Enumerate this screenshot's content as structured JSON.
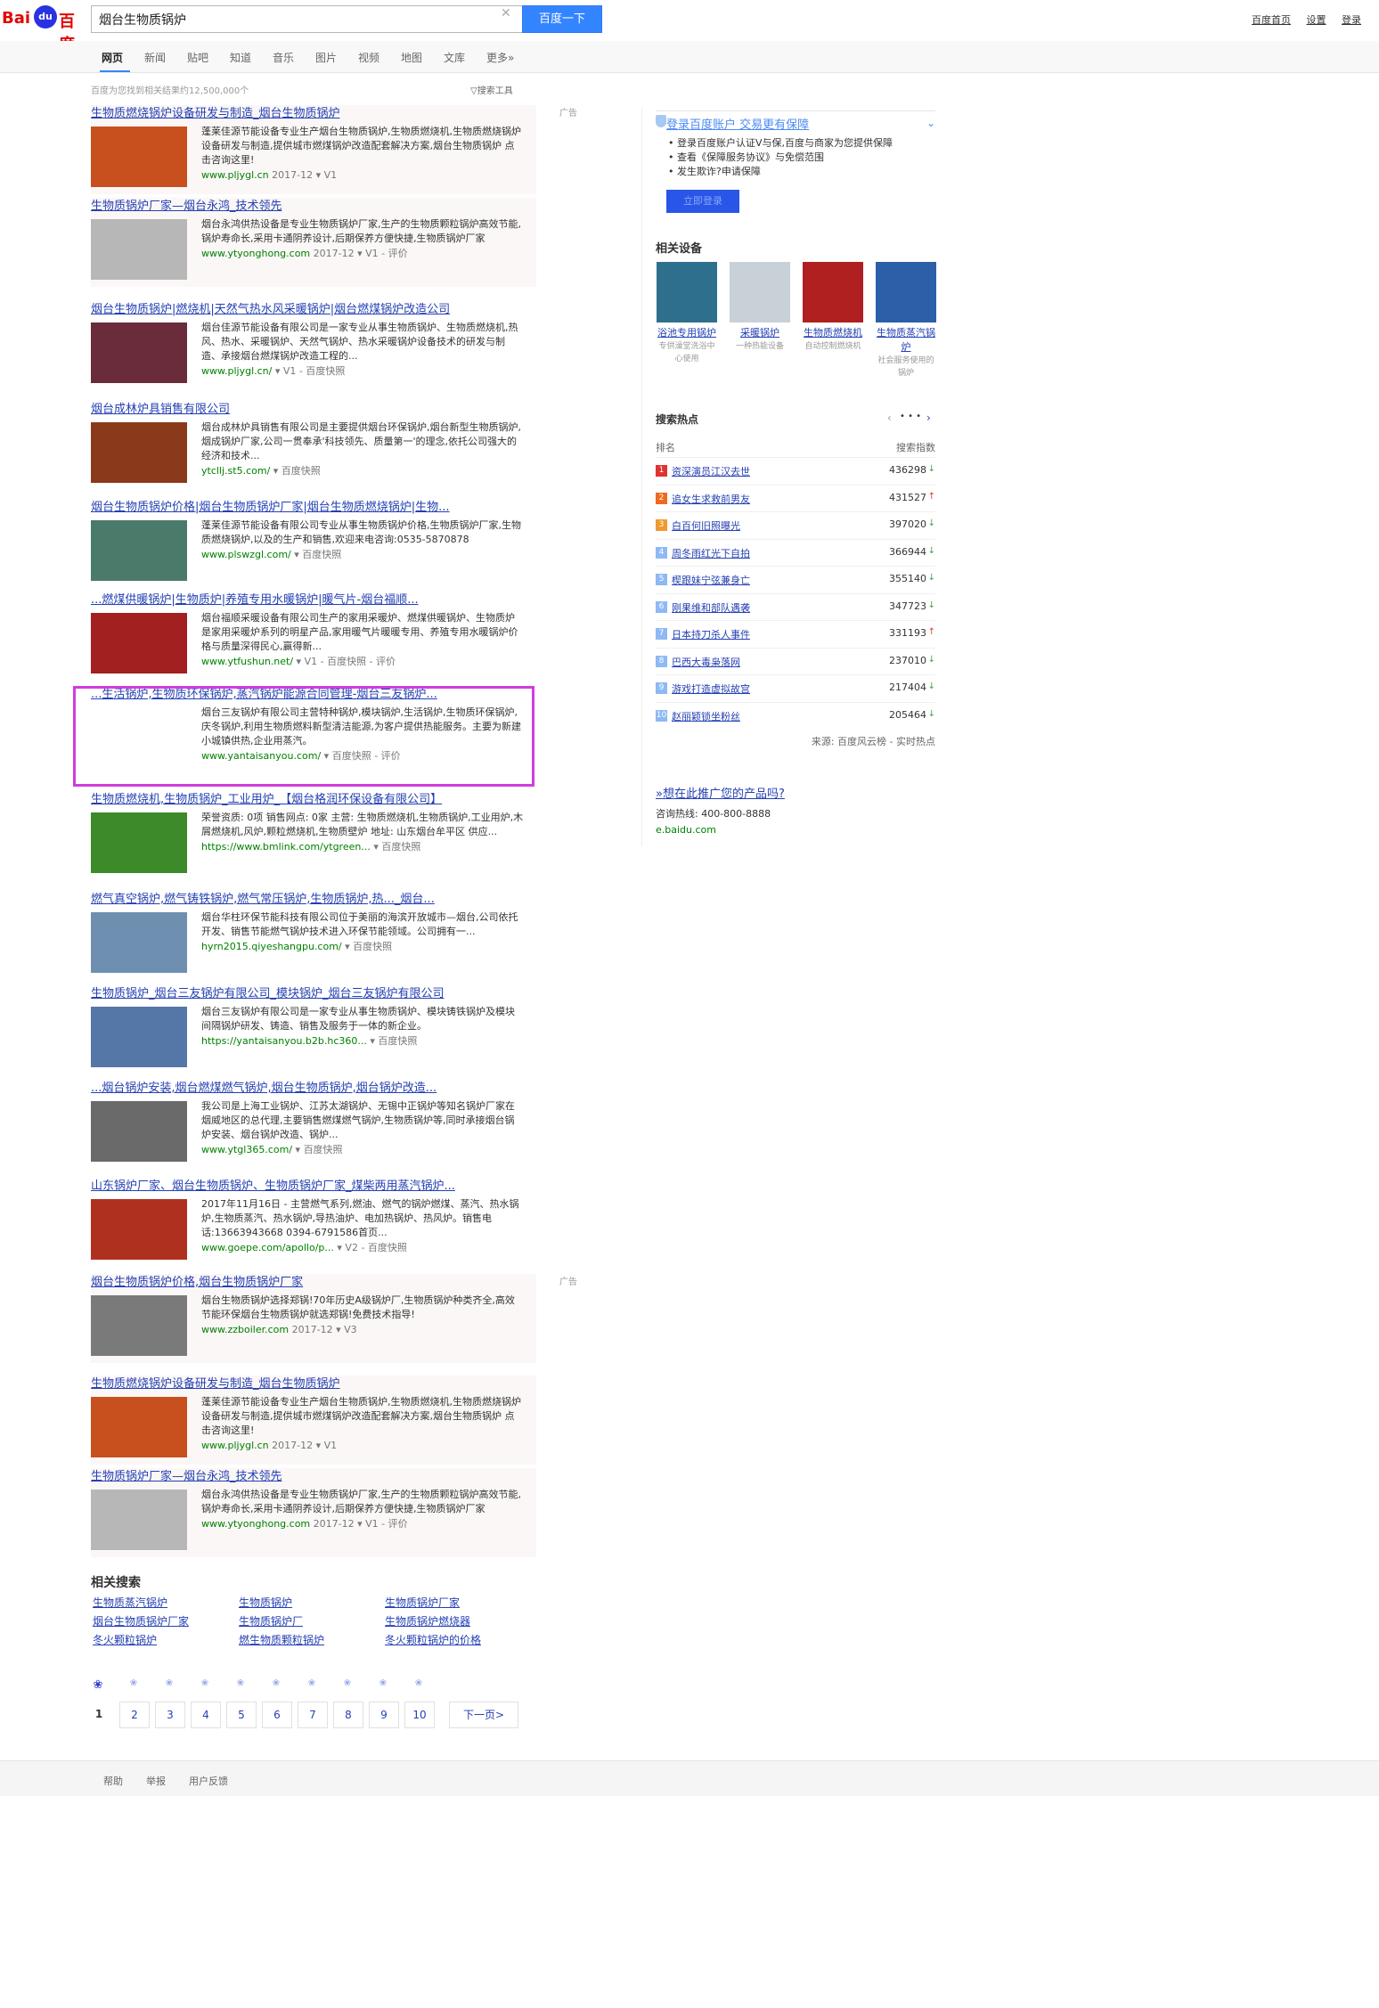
{
  "header": {
    "logo_left": "Bai",
    "logo_paw": "du",
    "logo_right": "百度",
    "query": "烟台生物质锅炉",
    "search_button": "百度一下",
    "links": [
      "百度首页",
      "设置",
      "登录"
    ]
  },
  "tabs": [
    "网页",
    "新闻",
    "贴吧",
    "知道",
    "音乐",
    "图片",
    "视频",
    "地图",
    "文库",
    "更多»"
  ],
  "result_count": "百度为您找到相关结果约12,500,000个",
  "search_tools": "搜索工具",
  "ad_label": "广告",
  "results": [
    {
      "title": "生物质燃烧锅炉设备研发与制造_烟台生物质锅炉",
      "snippet": "蓬莱佳源节能设备专业生产烟台生物质锅炉,生物质燃烧机,生物质燃烧锅炉设备研发与制造,提供城市燃煤锅炉改造配套解决方案,烟台生物质锅炉 点击咨询这里!",
      "source": "www.pljygl.cn",
      "date": "2017-12",
      "extra": "V1"
    },
    {
      "title": "生物质锅炉厂家—烟台永鸿_技术领先",
      "snippet": "烟台永鸿供热设备是专业生物质锅炉厂家,生产的生物质颗粒锅炉高效节能,锅炉寿命长,采用卡通阴养设计,后期保养方便快捷,生物质锅炉厂家",
      "source": "www.ytyonghong.com",
      "date": "2017-12",
      "extra": "V1 - 评价"
    },
    {
      "title": "烟台生物质锅炉|燃烧机|天然气热水风采暖锅炉|烟台燃煤锅炉改造公司",
      "snippet": "烟台佳源节能设备有限公司是一家专业从事生物质锅炉、生物质燃烧机,热风、热水、采暖锅炉、天然气锅炉、热水采暖锅炉设备技术的研发与制造、承接烟台燃煤锅炉改造工程的...",
      "source": "www.pljygl.cn/",
      "date": "",
      "extra": "V1 - 百度快照"
    },
    {
      "title": "烟台成林炉具销售有限公司",
      "snippet": "烟台成林炉具销售有限公司是主要提供烟台环保锅炉,烟台新型生物质锅炉,烟成锅炉厂家,公司一贯奉承'科技领先、质量第一'的理念,依托公司强大的经济和技术...",
      "source": "ytcllj.st5.com/",
      "date": "",
      "extra": "百度快照"
    },
    {
      "title": "烟台生物质锅炉价格|烟台生物质锅炉厂家|烟台生物质燃烧锅炉|生物...",
      "snippet": "蓬莱佳源节能设备有限公司专业从事生物质锅炉价格,生物质锅炉厂家,生物质燃烧锅炉,以及的生产和销售,欢迎来电咨询:0535-5870878",
      "source": "www.plswzgl.com/",
      "date": "",
      "extra": "百度快照"
    },
    {
      "title": "...燃煤供暖锅炉|生物质炉|养殖专用水暖锅炉|暖气片-烟台福顺...",
      "snippet": "烟台福顺采暖设备有限公司生产的家用采暖炉、燃煤供暖锅炉、生物质炉是家用采暖炉系列的明星产品,家用暖气片暖暖专用、养殖专用水暖锅炉价格与质量深得民心,赢得新...",
      "source": "www.ytfushun.net/",
      "date": "",
      "extra": "V1 - 百度快照 - 评价"
    },
    {
      "title": "...生活锅炉,生物质环保锅炉,蒸汽锅炉能源合同管理-烟台三友锅炉...",
      "snippet": "烟台三友锅炉有限公司主营特种锅炉,模块锅炉,生活锅炉,生物质环保锅炉,庆冬锅炉,利用生物质燃料新型清洁能源,为客户提供热能服务。主要为新建小城镇供热,企业用蒸汽。",
      "source": "www.yantaisanyou.com/",
      "date": "",
      "extra": "百度快照 - 评价"
    },
    {
      "title": "生物质燃烧机,生物质锅炉_工业用炉_【烟台格润环保设备有限公司】",
      "snippet": "荣誉资质: 0项 销售网点: 0家 主营: 生物质燃烧机,生物质锅炉,工业用炉,木屑燃烧机,风炉,颗粒燃烧机,生物质壁炉 地址: 山东烟台牟平区 供应...",
      "source": "https://www.bmlink.com/ytgreen...",
      "date": "",
      "extra": "百度快照"
    },
    {
      "title": "燃气真空锅炉,燃气铸铁锅炉,燃气常压锅炉,生物质锅炉,热..._烟台...",
      "snippet": "烟台华柱环保节能科技有限公司位于美丽的海滨开放城市—烟台,公司依托开发、销售节能燃气锅炉技术进入环保节能领域。公司拥有一...",
      "source": "hyrn2015.qiyeshangpu.com/",
      "date": "",
      "extra": "百度快照"
    },
    {
      "title": "生物质锅炉_烟台三友锅炉有限公司_模块锅炉_烟台三友锅炉有限公司",
      "snippet": "烟台三友锅炉有限公司是一家专业从事生物质锅炉、模块铸铁锅炉及模块间隔锅炉研发、铸造、销售及服务于一体的新企业。",
      "source": "https://yantaisanyou.b2b.hc360...",
      "date": "",
      "extra": "百度快照"
    },
    {
      "title": "...烟台锅炉安装,烟台燃煤燃气锅炉,烟台生物质锅炉,烟台锅炉改造...",
      "snippet": "我公司是上海工业锅炉、江苏太湖锅炉、无锡中正锅炉等知名锅炉厂家在烟威地区的总代理,主要销售燃煤燃气锅炉,生物质锅炉等,同时承接烟台锅炉安装、烟台锅炉改造、锅炉...",
      "source": "www.ytgl365.com/",
      "date": "",
      "extra": "百度快照"
    },
    {
      "title": "山东锅炉厂家、烟台生物质锅炉、生物质锅炉厂家_煤柴两用蒸汽锅炉...",
      "snippet": "2017年11月16日 - 主营燃气系列,燃油、燃气的锅炉燃煤、蒸汽、热水锅炉,生物质蒸汽、热水锅炉,导热油炉、电加热锅炉、热风炉。销售电话:13663943668 0394-6791586首页...",
      "source": "www.goepe.com/apollo/p...",
      "date": "",
      "extra": "V2 - 百度快照"
    },
    {
      "title": "烟台生物质锅炉价格,烟台生物质锅炉厂家",
      "snippet": "烟台生物质锅炉选择郑锅!70年历史A级锅炉厂,生物质锅炉种类齐全,高效节能环保烟台生物质锅炉就选郑锅!免费技术指导!",
      "source": "www.zzboiler.com",
      "date": "2017-12",
      "extra": "V3"
    },
    {
      "title": "生物质燃烧锅炉设备研发与制造_烟台生物质锅炉",
      "snippet": "蓬莱佳源节能设备专业生产烟台生物质锅炉,生物质燃烧机,生物质燃烧锅炉设备研发与制造,提供城市燃煤锅炉改造配套解决方案,烟台生物质锅炉 点击咨询这里!",
      "source": "www.pljygl.cn",
      "date": "2017-12",
      "extra": "V1"
    },
    {
      "title": "生物质锅炉厂家—烟台永鸿_技术领先",
      "snippet": "烟台永鸿供热设备是专业生物质锅炉厂家,生产的生物质颗粒锅炉高效节能,锅炉寿命长,采用卡通阴养设计,后期保养方便快捷,生物质锅炉厂家",
      "source": "www.ytyonghong.com",
      "date": "2017-12",
      "extra": "V1 - 评价"
    }
  ],
  "thumb_colors": [
    "#c8501f",
    "#b7b7b7",
    "#6a2b3a",
    "#8a3a1a",
    "#4a7a6a",
    "#a22020",
    "#ffffff",
    "#3c8a2a",
    "#6f8fb0",
    "#5577a8",
    "#6a6a6a",
    "#b03020",
    "#7a7a7a",
    "#c8501f",
    "#b7b7b7"
  ],
  "right": {
    "guard": {
      "title": "登录百度账户 交易更有保障",
      "lines": [
        "登录百度账户认证V与保,百度与商家为您提供保障",
        "查看《保障服务协议》与免偿范围",
        "发生欺诈?申请保障"
      ],
      "button": "立即登录"
    },
    "equip_title": "相关设备",
    "equip": [
      {
        "name": "浴池专用锅炉",
        "desc": "专供澡堂洗浴中心使用",
        "color": "#2e6f8e"
      },
      {
        "name": "采暖锅炉",
        "desc": "一种热能设备",
        "color": "#c8d0d8"
      },
      {
        "name": "生物质燃烧机",
        "desc": "自动控制燃烧机",
        "color": "#b02020"
      },
      {
        "name": "生物质蒸汽锅炉",
        "desc": "社会服务使用的锅炉",
        "color": "#2b5fa8"
      }
    ],
    "hot_title": "搜索热点",
    "hot_head_left": "排名",
    "hot_head_right": "搜索指数",
    "hot": [
      {
        "rank": "1",
        "name": "资深演员江汉去世",
        "value": "436298",
        "dir": "↓",
        "color": "#e0332f"
      },
      {
        "rank": "2",
        "name": "追女生求救前男友",
        "value": "431527",
        "dir": "↑",
        "color": "#f06a1e"
      },
      {
        "rank": "3",
        "name": "白百何旧照曝光",
        "value": "397020",
        "dir": "↓",
        "color": "#f09a2e"
      },
      {
        "rank": "4",
        "name": "周冬雨红光下自拍",
        "value": "366944",
        "dir": "↓",
        "color": "#8eb9f5"
      },
      {
        "rank": "5",
        "name": "楔跟妹宁弦兼身亡",
        "value": "355140",
        "dir": "↓",
        "color": "#8eb9f5"
      },
      {
        "rank": "6",
        "name": "刚果维和部队遇袭",
        "value": "347723",
        "dir": "↓",
        "color": "#8eb9f5"
      },
      {
        "rank": "7",
        "name": "日本持刀杀人事件",
        "value": "331193",
        "dir": "↑",
        "color": "#8eb9f5"
      },
      {
        "rank": "8",
        "name": "巴西大毒枭落网",
        "value": "237010",
        "dir": "↓",
        "color": "#8eb9f5"
      },
      {
        "rank": "9",
        "name": "游戏打造虚拟故宫",
        "value": "217404",
        "dir": "↓",
        "color": "#8eb9f5"
      },
      {
        "rank": "10",
        "name": "赵丽颖锁坐粉丝",
        "value": "205464",
        "dir": "↓",
        "color": "#8eb9f5"
      }
    ],
    "hot_source": "来源: 百度风云榜 - 实时热点",
    "promo_title": "»想在此推广您的产品吗?",
    "promo_phone": "咨询热线: 400-800-8888",
    "promo_site": "e.baidu.com"
  },
  "related": {
    "title": "相关搜索",
    "items": [
      "生物质蒸汽锅炉",
      "生物质锅炉",
      "生物质锅炉厂家",
      "烟台生物质锅炉厂家",
      "生物质锅炉厂",
      "生物质锅炉燃烧器",
      "冬火颗粒锅炉",
      "燃生物质颗粒锅炉",
      "冬火颗粒锅炉的价格"
    ]
  },
  "pager": {
    "pages": [
      "1",
      "2",
      "3",
      "4",
      "5",
      "6",
      "7",
      "8",
      "9",
      "10"
    ],
    "next": "下一页>"
  },
  "footer": [
    "帮助",
    "举报",
    "用户反馈"
  ]
}
